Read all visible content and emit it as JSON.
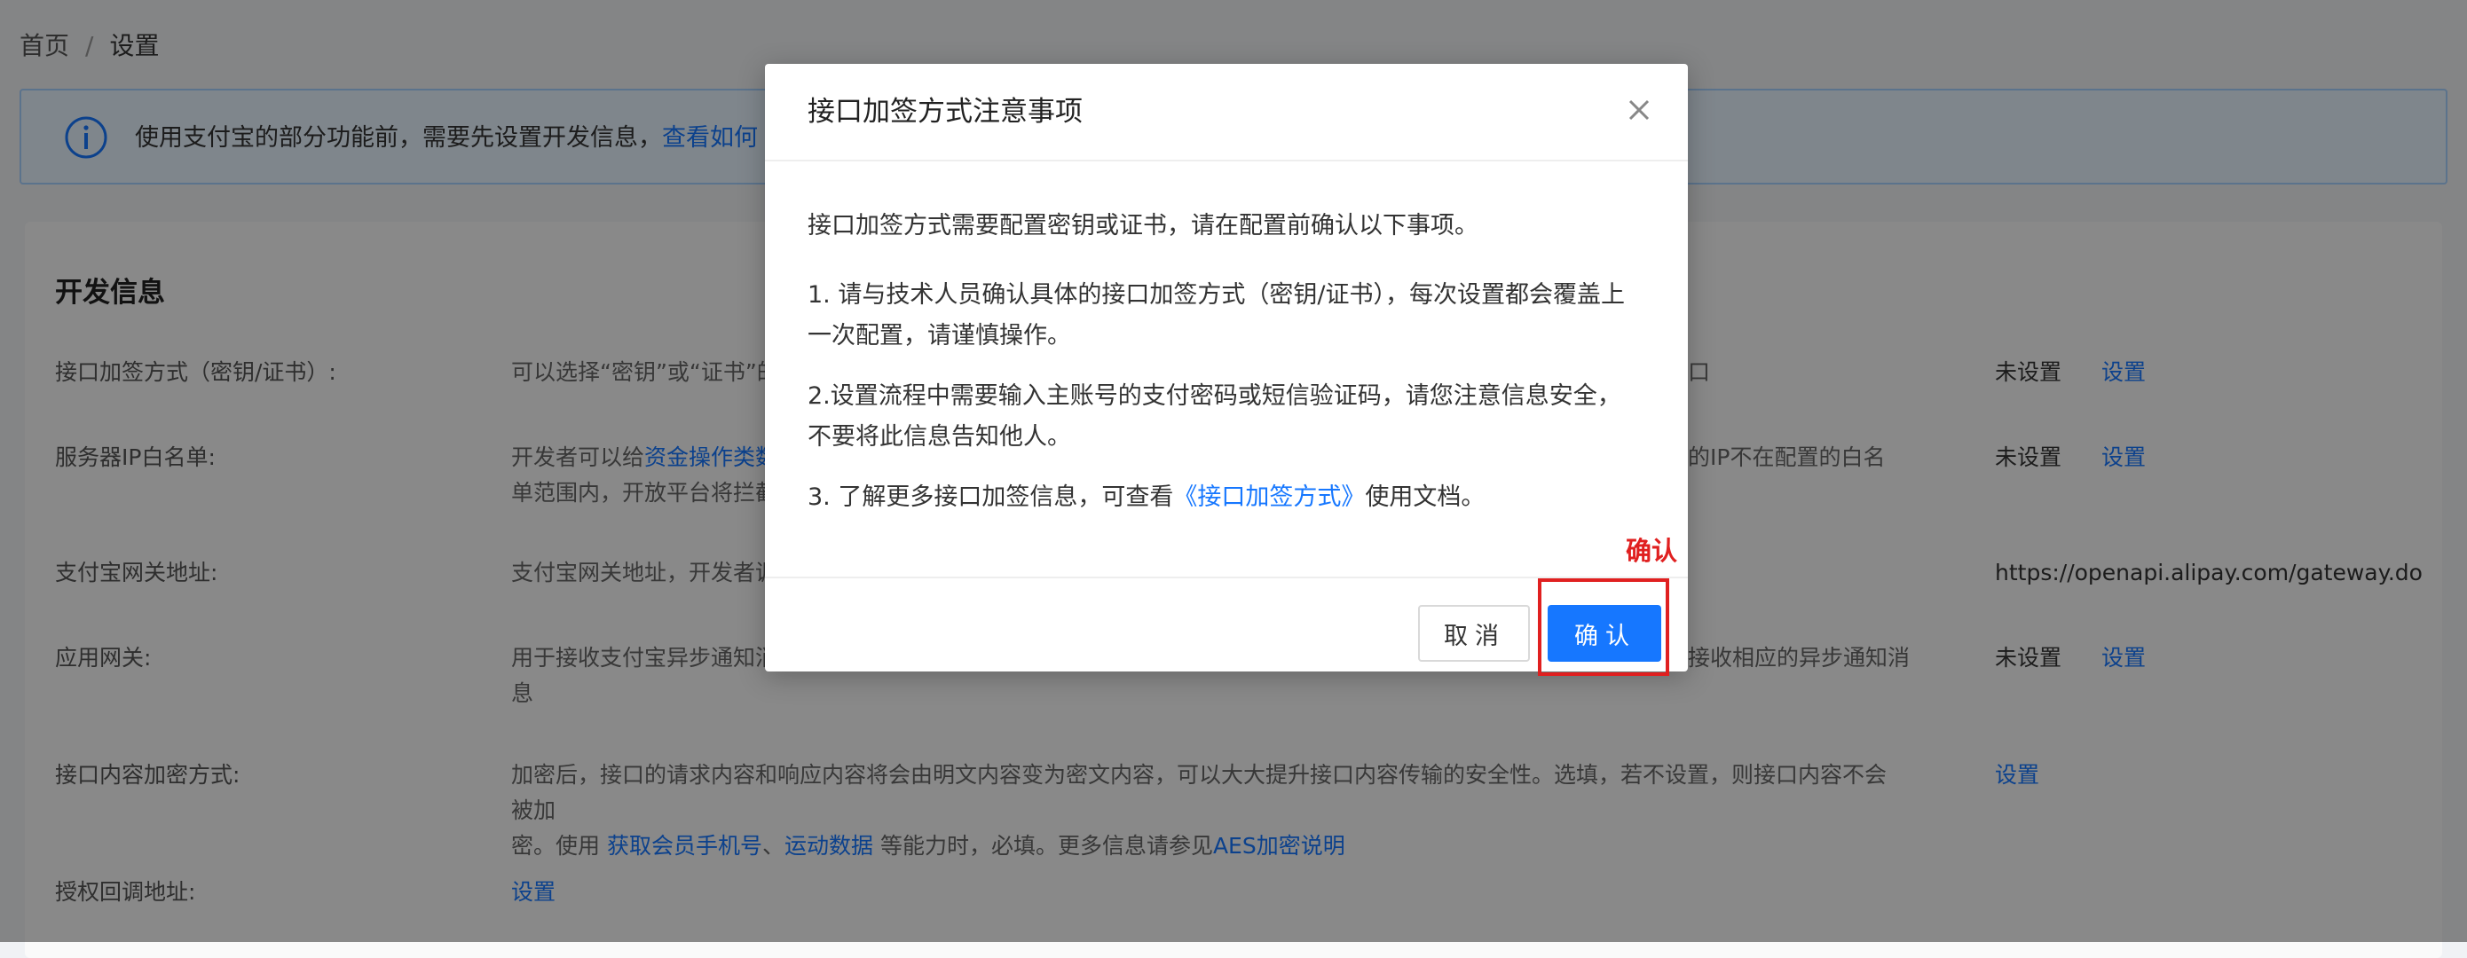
{
  "breadcrumb": {
    "home": "首页",
    "separator": "/",
    "current": "设置"
  },
  "notice": {
    "icon": "info-icon",
    "text": "使用支付宝的部分功能前，需要先设置开发信息，",
    "link_text": "查看如何"
  },
  "section": {
    "title": "开发信息",
    "rows": [
      {
        "label": "接口加签方式（密钥/证书）:",
        "desc": "可以选择“密钥”或“证书”的接",
        "right": "口",
        "status": "未设置",
        "action": "设置"
      },
      {
        "label": "服务器IP白名单:",
        "desc_prefix": "开发者可以给",
        "desc_link": "资金操作类数",
        "desc_line2": "单范围内，开放平台将拦截",
        "right": "的IP不在配置的白名",
        "status": "未设置",
        "action": "设置"
      },
      {
        "label": "支付宝网关地址:",
        "desc": "支付宝网关地址，开发者调",
        "status": "https://openapi.alipay.com/gateway.do"
      },
      {
        "label": "应用网关:",
        "desc": "用于接收支付宝异步通知消",
        "desc_line2": "息",
        "right": "接收相应的异步通知消",
        "status": "未设置",
        "action": "设置"
      },
      {
        "label": "接口内容加密方式:",
        "desc": "加密后，接口的请求内容和响应内容将会由明文内容变为密文内容，可以大大提升接口内容传输的安全性。选填，若不设置，则接口内容不会被加",
        "desc_line2_prefix": "密。使用 ",
        "desc_link1": "获取会员手机号",
        "desc_sep": "、",
        "desc_link2": "运动数据",
        "desc_line2_mid": " 等能力时，必填。更多信息请参见",
        "desc_link3": "AES加密说明",
        "action": "设置"
      },
      {
        "label": "授权回调地址:",
        "action": "设置"
      }
    ]
  },
  "modal": {
    "title": "接口加签方式注意事项",
    "close_icon": "close-icon",
    "p1": "接口加签方式需要配置密钥或证书，请在配置前确认以下事项。",
    "p2": "1. 请与技术人员确认具体的接口加签方式（密钥/证书），每次设置都会覆盖上一次配置，请谨慎操作。",
    "p3": "2.设置流程中需要输入主账号的支付密码或短信验证码，请您注意信息安全，不要将此信息告知他人。",
    "p4_prefix": "3. 了解更多接口加签信息，可查看",
    "p4_link": "《接口加签方式》",
    "p4_suffix": "使用文档。",
    "cancel_label": "取消",
    "ok_label": "确认"
  },
  "annotation": {
    "text": "确认",
    "color": "#e02020"
  },
  "colors": {
    "primary": "#1677ff",
    "mask": "rgba(0,0,0,0.45)",
    "notice_bg": "#e8f4ff"
  }
}
